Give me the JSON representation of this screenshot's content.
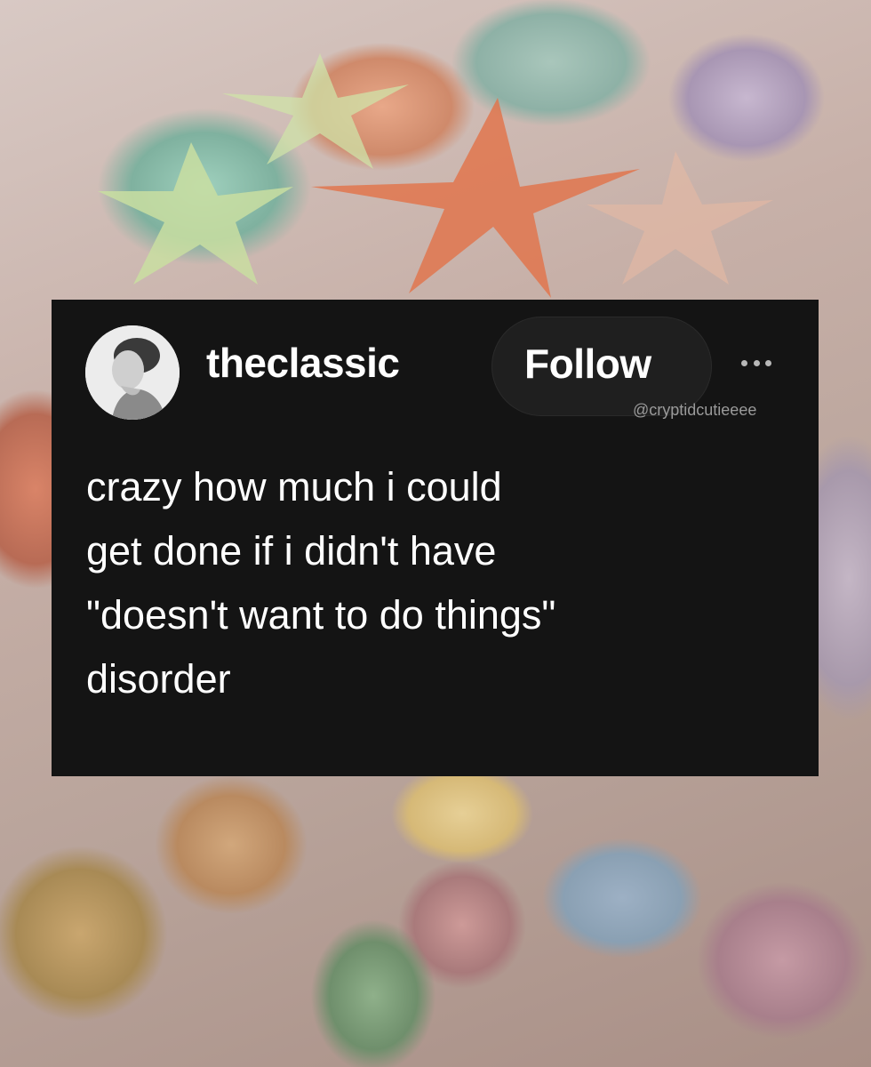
{
  "post": {
    "username": "theclassic",
    "follow_label": "Follow",
    "more_icon": "more-horizontal-icon",
    "watermark": "@cryptidcutieeee",
    "lines": [
      "crazy how much i could",
      "get done if i didn't have",
      "\"doesn't want to do things\"",
      "disorder"
    ]
  },
  "colors": {
    "card_background": "#141414",
    "text": "#ffffff",
    "button_background": "#1f1f1f",
    "watermark": "#9a9a9a"
  }
}
